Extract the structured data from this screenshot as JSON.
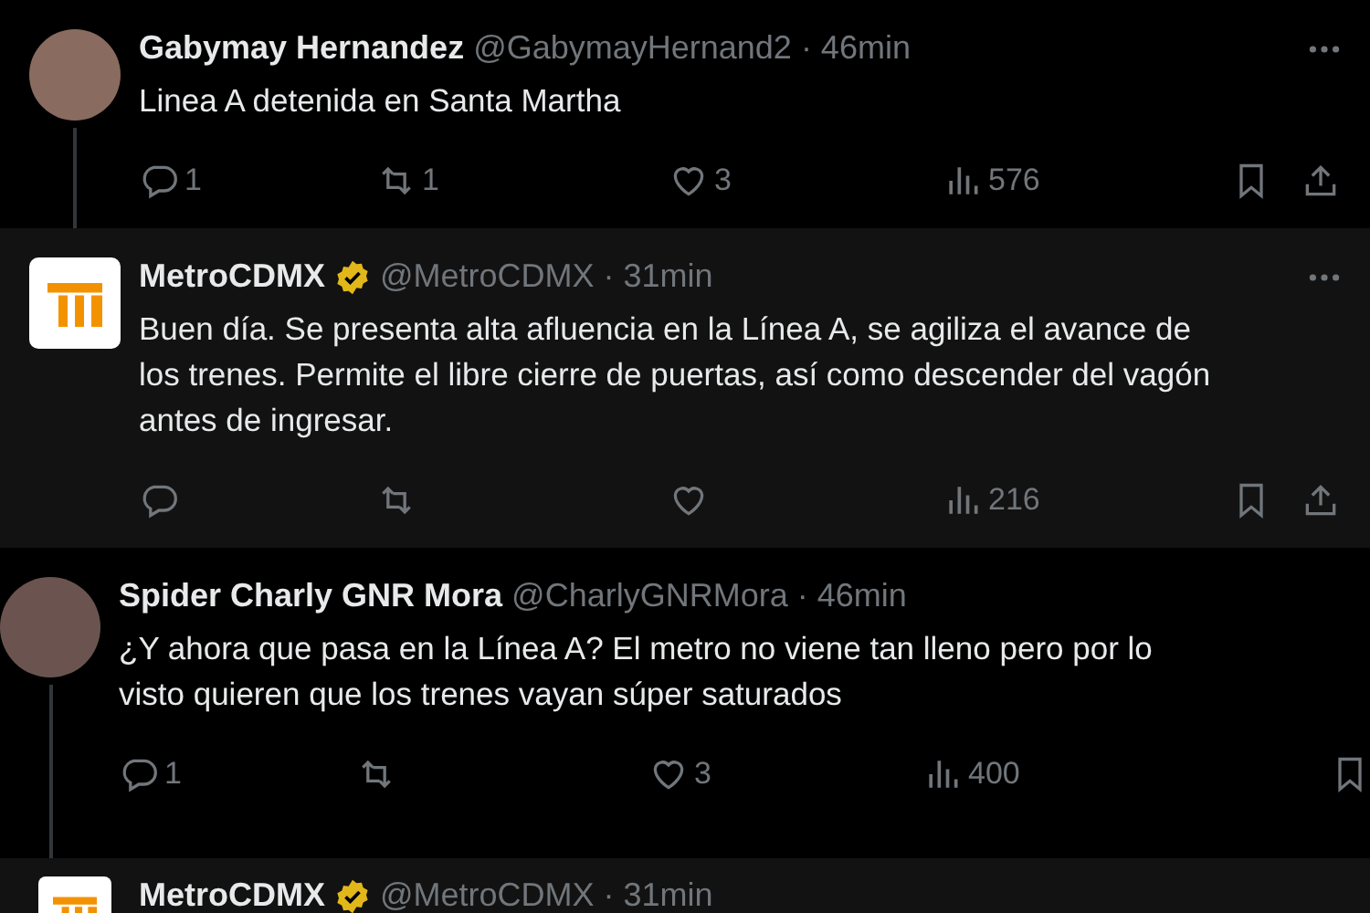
{
  "tweets": [
    {
      "kind": "photo",
      "name": "Gabymay Hernandez",
      "verified": false,
      "handle": "@GabymayHernand2",
      "time": "· 46min",
      "menu": true,
      "thread_line": true,
      "highlighted": false,
      "lines": [
        "Linea A detenida en Santa Martha"
      ],
      "actions": [
        {
          "kind": "reply",
          "count": "1"
        },
        {
          "kind": "repost",
          "count": "1"
        },
        {
          "kind": "like",
          "count": "3"
        },
        {
          "kind": "views",
          "count": "576"
        },
        {
          "kind": "bookmark"
        },
        {
          "kind": "share"
        }
      ]
    },
    {
      "kind": "logo",
      "name": "MetroCDMX",
      "verified": true,
      "handle": "@MetroCDMX",
      "time": "· 31min",
      "menu": true,
      "thread_line": false,
      "highlighted": true,
      "lines": [
        "Buen día. Se presenta alta afluencia en la Línea A, se agiliza el avance de",
        "los trenes. Permite el libre cierre de puertas, así como descender del vagón",
        "antes de ingresar."
      ],
      "actions": [
        {
          "kind": "reply"
        },
        {
          "kind": "repost"
        },
        {
          "kind": "like"
        },
        {
          "kind": "views",
          "count": "216"
        },
        {
          "kind": "bookmark"
        },
        {
          "kind": "share"
        }
      ]
    },
    {
      "kind": "photo",
      "name": "Spider Charly GNR Mora",
      "verified": false,
      "handle": "@CharlyGNRMora",
      "time": "· 46min",
      "menu": false,
      "thread_line": true,
      "highlighted": false,
      "lines": [
        "¿Y ahora que pasa en la Línea A? El metro no viene tan lleno pero por lo",
        "visto quieren que los trenes vayan súper saturados"
      ],
      "actions": [
        {
          "kind": "reply",
          "count": "1"
        },
        {
          "kind": "repost"
        },
        {
          "kind": "like",
          "count": "3"
        },
        {
          "kind": "views",
          "count": "400"
        },
        {
          "kind": "bookmark"
        }
      ]
    },
    {
      "kind": "logo",
      "name": "MetroCDMX",
      "verified": true,
      "handle": "@MetroCDMX",
      "time": "· 31min",
      "menu": false,
      "thread_line": false,
      "highlighted": true
    }
  ]
}
